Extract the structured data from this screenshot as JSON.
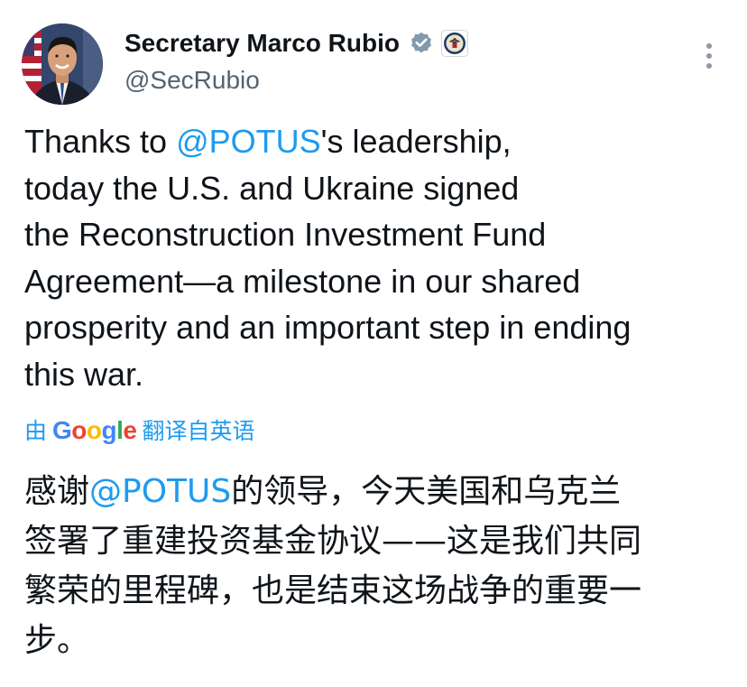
{
  "author": {
    "name": "Secretary Marco Rubio",
    "handle": "@SecRubio"
  },
  "badges": {
    "verified_icon": "verified-badge-icon",
    "verified_color": "#829aab",
    "affiliation_icon": "state-department-seal-icon"
  },
  "tweet": {
    "lines": [
      {
        "pre": "Thanks to ",
        "mention": "@POTUS",
        "post": "'s leadership,"
      },
      {
        "text": "today the U.S. and Ukraine signed"
      },
      {
        "text": "the Reconstruction Investment Fund"
      },
      {
        "text": "Agreement—a milestone in our shared"
      },
      {
        "text": "prosperity and an important step in ending"
      },
      {
        "text": "this war."
      }
    ]
  },
  "translation": {
    "prefix": "由",
    "google": [
      "G",
      "o",
      "o",
      "g",
      "l",
      "e"
    ],
    "suffix": "翻译自英语",
    "lines": [
      {
        "pre": "感谢",
        "mention": "@POTUS",
        "post": "的领导，今天美国和乌克兰"
      },
      {
        "text": "签署了重建投资基金协议——这是我们共同"
      },
      {
        "text": "繁荣的里程碑，也是结束这场战争的重要一"
      },
      {
        "text": "步。"
      }
    ]
  },
  "colors": {
    "link": "#1d9bf0",
    "text": "#0f1419",
    "secondary": "#536471"
  }
}
